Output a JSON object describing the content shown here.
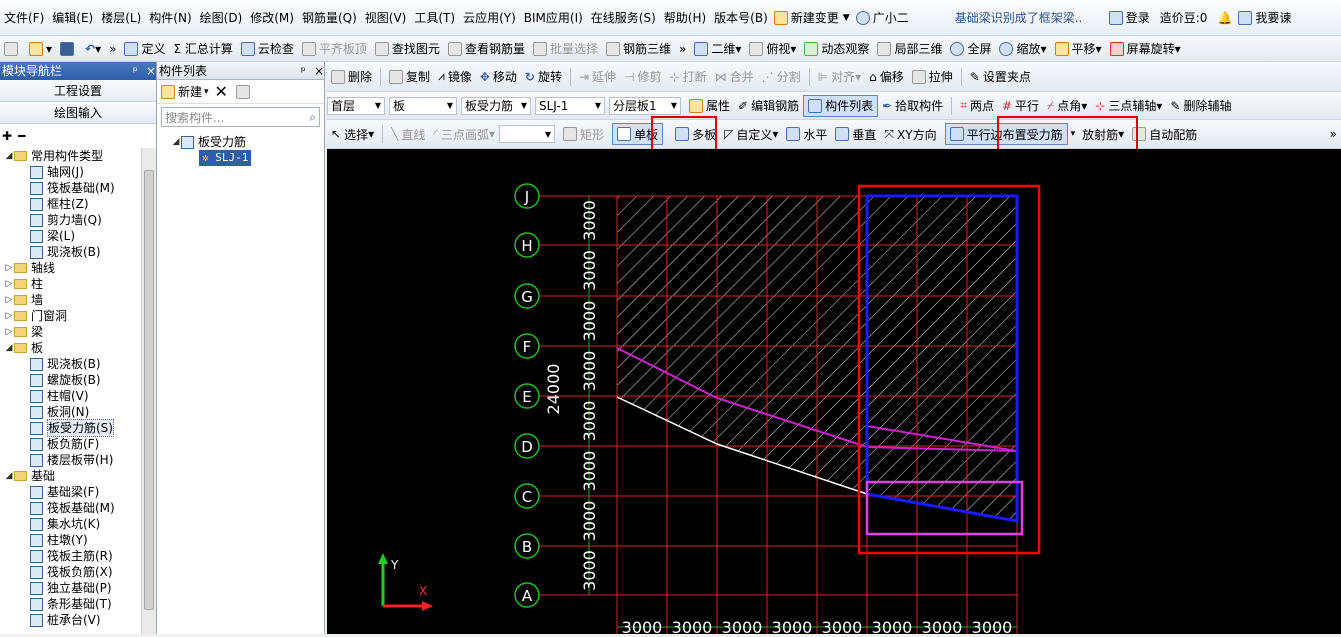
{
  "menu": [
    "文件(F)",
    "编辑(E)",
    "楼层(L)",
    "构件(N)",
    "绘图(D)",
    "修改(M)",
    "钢筋量(Q)",
    "视图(V)",
    "工具(T)",
    "云应用(Y)",
    "BIM应用(I)",
    "在线服务(S)",
    "帮助(H)",
    "版本号(B)",
    "新建变更",
    "广小二"
  ],
  "notice": "基础梁识别成了框架梁..",
  "login": "登录",
  "cost_bean": "造价豆:0",
  "want_to_ask": "我要谏",
  "toolbar1": [
    "定义",
    "Σ 汇总计算",
    "云检查",
    "平齐板顶",
    "查找图元",
    "查看钢筋量",
    "批量选择",
    "钢筋三维",
    "二维",
    "俯视",
    "动态观察",
    "局部三维",
    "全屏",
    "缩放",
    "平移",
    "屏幕旋转"
  ],
  "nav_panel": {
    "title": "模块导航栏",
    "buttons": [
      "工程设置",
      "绘图输入"
    ],
    "tree": [
      {
        "label": "常用构件类型",
        "type": "folder",
        "open": true,
        "level": 0
      },
      {
        "label": "轴网(J)",
        "level": 1
      },
      {
        "label": "筏板基础(M)",
        "level": 1
      },
      {
        "label": "框柱(Z)",
        "level": 1
      },
      {
        "label": "剪力墙(Q)",
        "level": 1
      },
      {
        "label": "梁(L)",
        "level": 1
      },
      {
        "label": "现浇板(B)",
        "level": 1
      },
      {
        "label": "轴线",
        "type": "folder",
        "level": 0
      },
      {
        "label": "柱",
        "type": "folder",
        "level": 0
      },
      {
        "label": "墙",
        "type": "folder",
        "level": 0
      },
      {
        "label": "门窗洞",
        "type": "folder",
        "level": 0
      },
      {
        "label": "梁",
        "type": "folder",
        "level": 0
      },
      {
        "label": "板",
        "type": "folder",
        "open": true,
        "level": 0
      },
      {
        "label": "现浇板(B)",
        "level": 1
      },
      {
        "label": "螺旋板(B)",
        "level": 1
      },
      {
        "label": "柱帽(V)",
        "level": 1
      },
      {
        "label": "板洞(N)",
        "level": 1
      },
      {
        "label": "板受力筋(S)",
        "level": 1,
        "selected": true
      },
      {
        "label": "板负筋(F)",
        "level": 1
      },
      {
        "label": "楼层板带(H)",
        "level": 1
      },
      {
        "label": "基础",
        "type": "folder",
        "open": true,
        "level": 0
      },
      {
        "label": "基础梁(F)",
        "level": 1
      },
      {
        "label": "筏板基础(M)",
        "level": 1
      },
      {
        "label": "集水坑(K)",
        "level": 1
      },
      {
        "label": "柱墩(Y)",
        "level": 1
      },
      {
        "label": "筏板主筋(R)",
        "level": 1
      },
      {
        "label": "筏板负筋(X)",
        "level": 1
      },
      {
        "label": "独立基础(P)",
        "level": 1
      },
      {
        "label": "条形基础(T)",
        "level": 1
      },
      {
        "label": "桩承台(V)",
        "level": 1
      }
    ]
  },
  "comp_panel": {
    "title": "构件列表",
    "new_label": "新建",
    "search_placeholder": "搜索构件...",
    "tree_root": "板受力筋",
    "tree_child": "SLJ-1"
  },
  "toolbar2": [
    "删除",
    "复制",
    "镜像",
    "移动",
    "旋转",
    "延伸",
    "修剪",
    "打断",
    "合并",
    "分割",
    "对齐",
    "偏移",
    "拉伸",
    "设置夹点"
  ],
  "toolbar3": {
    "floor": "首层",
    "category": "板",
    "type": "板受力筋",
    "component": "SLJ-1",
    "layer": "分层板1",
    "buttons": [
      "属性",
      "编辑钢筋",
      "构件列表",
      "拾取构件",
      "两点",
      "平行",
      "点角",
      "三点辅轴",
      "删除辅轴"
    ]
  },
  "toolbar4": [
    "选择",
    "直线",
    "三点画弧",
    "矩形",
    "单板",
    "多板",
    "自定义",
    "水平",
    "垂直",
    "XY方向",
    "平行边布置受力筋",
    "放射筋",
    "自动配筋"
  ],
  "drawing": {
    "axis_labels_y": [
      "J",
      "H",
      "G",
      "F",
      "E",
      "D",
      "C",
      "B",
      "A"
    ],
    "dim_y": [
      "3000",
      "3000",
      "3000",
      "3000",
      "3000",
      "3000",
      "3000",
      "3000"
    ],
    "total_y": "24000",
    "dim_x": [
      "3000",
      "3000",
      "3000",
      "3000",
      "3000",
      "3000",
      "3000",
      "3000"
    ],
    "ucs_y": "Y",
    "ucs_x": "X"
  }
}
